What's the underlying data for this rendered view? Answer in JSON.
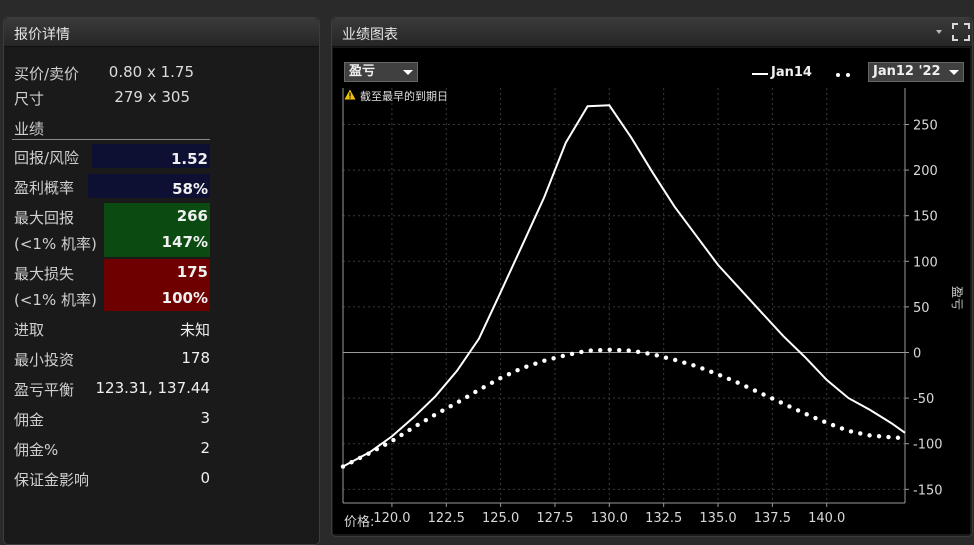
{
  "quote_panel": {
    "title": "报价详情",
    "bid_ask": {
      "label": "买价/卖价",
      "value": "0.80 x 1.75"
    },
    "size": {
      "label": "尺寸",
      "value": "279 x 305"
    },
    "performance_section": "业绩",
    "return_risk": {
      "label": "回报/风险",
      "value": "1.52"
    },
    "prob_profit": {
      "label": "盈利概率",
      "value": "58%"
    },
    "max_return": {
      "label": "最大回报",
      "value": "266",
      "sub_label": "(<1% 机率)",
      "sub_value": "147%"
    },
    "max_loss": {
      "label": "最大损失",
      "value": "175",
      "sub_label": "(<1% 机率)",
      "sub_value": "100%"
    },
    "aggressive": {
      "label": "进取",
      "value": "未知"
    },
    "min_invest": {
      "label": "最小投资",
      "value": "178"
    },
    "breakeven": {
      "label": "盈亏平衡",
      "value": "123.31, 137.44"
    },
    "commission": {
      "label": "佣金",
      "value": "3"
    },
    "commission_pct": {
      "label": "佣金%",
      "value": "2"
    },
    "margin_impact": {
      "label": "保证金影响",
      "value": "0"
    },
    "colors": {
      "navy": "#0d0f33",
      "green": "#0b4a10",
      "red": "#6e0000"
    }
  },
  "chart_panel": {
    "title": "业绩图表",
    "mode_select": "盈亏",
    "legend_solid": "Jan14",
    "legend_dotted_select": "Jan12 '22",
    "warning": "截至最早的到期日",
    "x_prefix": "价格:"
  },
  "chart_data": {
    "type": "line",
    "ylabel": "盈亏",
    "xlim": [
      117.75,
      143.6
    ],
    "ylim": [
      -165,
      290
    ],
    "x_ticks": [
      "120.0",
      "122.5",
      "125.0",
      "127.5",
      "130.0",
      "132.5",
      "135.0",
      "137.5",
      "140.0"
    ],
    "y_ticks": [
      "250",
      "200",
      "150",
      "100",
      "50",
      "0",
      "-50",
      "-100",
      "-150"
    ],
    "grid": true,
    "zero_line": true,
    "series": [
      {
        "name": "Jan14",
        "style": "solid",
        "color": "#ffffff",
        "x": [
          117.75,
          119,
          120,
          121,
          122,
          123,
          124,
          125,
          126,
          127,
          128,
          129,
          130,
          131,
          132,
          133,
          134,
          135,
          136,
          137,
          138,
          139,
          140,
          141,
          142,
          143,
          143.6
        ],
        "y": [
          -125,
          -109,
          -92,
          -71,
          -48,
          -20,
          15,
          66,
          118,
          170,
          230,
          270,
          271,
          236,
          197,
          160,
          128,
          96,
          70,
          44,
          18,
          -5,
          -30,
          -50,
          -63,
          -78,
          -88
        ]
      },
      {
        "name": "Jan12 '22",
        "style": "dotted",
        "color": "#ffffff",
        "x": [
          117.75,
          119,
          120,
          121,
          122,
          123,
          124,
          125,
          126,
          127,
          128,
          129,
          130,
          131,
          132,
          133,
          134,
          135,
          136,
          137,
          138,
          139,
          140,
          141,
          142,
          143,
          143.6
        ],
        "y": [
          -125,
          -110,
          -97,
          -82,
          -68,
          -55,
          -41,
          -28,
          -17,
          -9,
          -3,
          2,
          3,
          2,
          -2,
          -8,
          -15,
          -24,
          -34,
          -45,
          -56,
          -67,
          -77,
          -86,
          -91,
          -93,
          -94
        ]
      }
    ]
  }
}
